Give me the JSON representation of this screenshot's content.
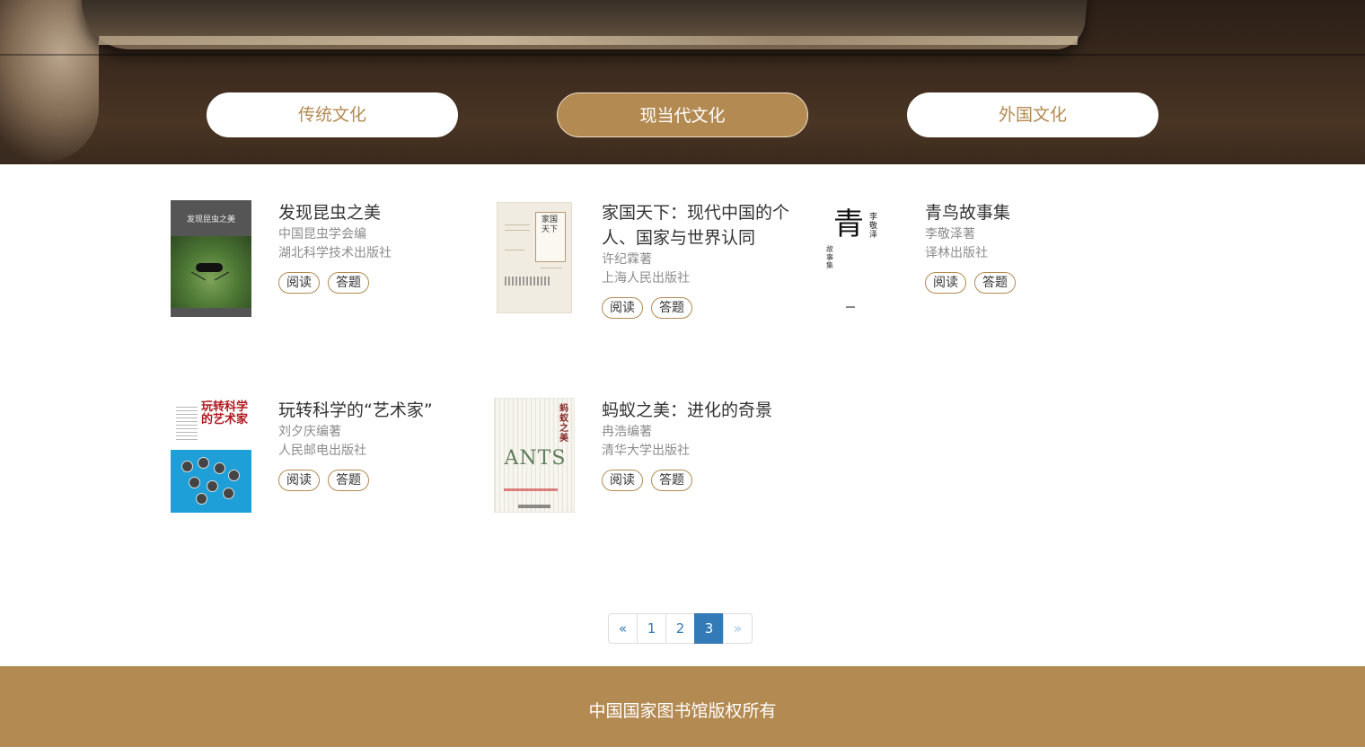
{
  "tabs": [
    {
      "label": "传统文化",
      "active": false
    },
    {
      "label": "现当代文化",
      "active": true
    },
    {
      "label": "外国文化",
      "active": false
    }
  ],
  "books": [
    {
      "title": "发现昆虫之美",
      "author": "中国昆虫学会编",
      "publisher": "湖北科学技术出版社",
      "read_label": "阅读",
      "quiz_label": "答题",
      "cover_text": "发现昆虫之美"
    },
    {
      "title": "家国天下：现代中国的个人、国家与世界认同",
      "author": "许纪霖著",
      "publisher": "上海人民出版社",
      "read_label": "阅读",
      "quiz_label": "答题",
      "cover_text": "家国天下"
    },
    {
      "title": "青鸟故事集",
      "author": "李敬泽著",
      "publisher": "译林出版社",
      "read_label": "阅读",
      "quiz_label": "答题",
      "cover_text": "青",
      "cover_side": "李敬泽",
      "cover_small": "故事集"
    },
    {
      "title": "玩转科学的“艺术家”",
      "author": "刘夕庆编著",
      "publisher": "人民邮电出版社",
      "read_label": "阅读",
      "quiz_label": "答题",
      "cover_text": "玩转科学的艺术家"
    },
    {
      "title": "蚂蚁之美：进化的奇景",
      "author": "冉浩编著",
      "publisher": "清华大学出版社",
      "read_label": "阅读",
      "quiz_label": "答题",
      "cover_text": "ANTS",
      "cover_side": "蚂蚁之美"
    }
  ],
  "pagination": {
    "prev": "«",
    "pages": [
      "1",
      "2",
      "3"
    ],
    "current": "3",
    "next": "»"
  },
  "footer": {
    "copyright": "中国国家图书馆版权所有"
  },
  "colors": {
    "accent": "#b38a52",
    "link": "#337ab7"
  }
}
